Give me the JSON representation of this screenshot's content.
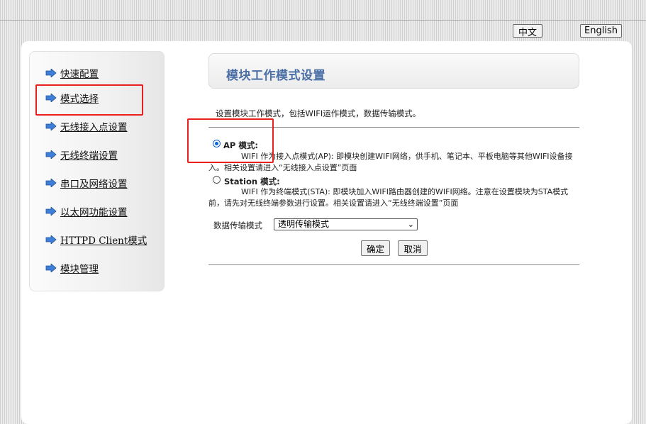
{
  "header": {
    "lang_chinese": "中文",
    "lang_english": "English"
  },
  "sidebar": {
    "items": [
      {
        "label": "快速配置",
        "icon": "arrow-right-icon"
      },
      {
        "label": "模式选择",
        "icon": "arrow-right-icon"
      },
      {
        "label": "无线接入点设置",
        "icon": "arrow-right-icon"
      },
      {
        "label": "无线终端设置",
        "icon": "arrow-right-icon"
      },
      {
        "label": "串口及网络设置",
        "icon": "arrow-right-icon"
      },
      {
        "label": "以太网功能设置",
        "icon": "arrow-right-icon"
      },
      {
        "label": "HTTPD Client模式",
        "icon": "arrow-right-icon"
      },
      {
        "label": "模块管理",
        "icon": "arrow-right-icon"
      }
    ],
    "selected": "模式选择"
  },
  "main": {
    "title": "模块工作模式设置",
    "description": "设置模块工作模式，包括WIFI运作模式，数据传输模式。",
    "modes": [
      {
        "label": "AP 模式:",
        "checked": true,
        "description": "WIFI 作为接入点模式(AP): 即模块创建WIFI网络，供手机、笔记本、平板电脑等其他WIFI设备接入。相关设置请进入“无线接入点设置”页面"
      },
      {
        "label": "Station 模式:",
        "checked": false,
        "description": "WIFI 作为终端模式(STA): 即模块加入WIFI路由器创建的WIFI网络。注意在设置模块为STA模式前，请先对无线终端参数进行设置。相关设置请进入“无线终端设置”页面"
      }
    ],
    "transfer_mode_label": "数据传输模式",
    "transfer_mode_value": "透明传输模式",
    "ok_button": "确定",
    "cancel_button": "取消"
  },
  "colors": {
    "title_text": "#4a6fa5",
    "highlight_box": "#e8201e",
    "arrow_icon": "#3d7fd9",
    "radio_checked": "#0a64d8"
  }
}
